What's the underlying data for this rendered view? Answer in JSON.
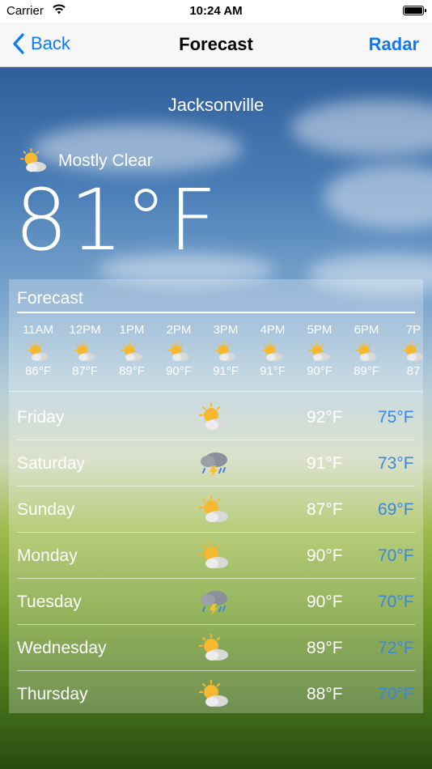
{
  "status_bar": {
    "carrier": "Carrier",
    "time": "10:24 AM"
  },
  "nav": {
    "back_label": "Back",
    "title": "Forecast",
    "right_label": "Radar"
  },
  "current": {
    "city": "Jacksonville",
    "condition": "Mostly Clear",
    "condition_icon": "sun-cloud-icon",
    "temperature": "81°F"
  },
  "forecast_panel": {
    "title": "Forecast",
    "hourly": [
      {
        "time": "11AM",
        "temp": "86°F",
        "icon": "sun-cloud-icon"
      },
      {
        "time": "12PM",
        "temp": "87°F",
        "icon": "sun-cloud-icon"
      },
      {
        "time": "1PM",
        "temp": "89°F",
        "icon": "sun-cloud-icon"
      },
      {
        "time": "2PM",
        "temp": "90°F",
        "icon": "sun-cloud-icon"
      },
      {
        "time": "3PM",
        "temp": "91°F",
        "icon": "sun-cloud-icon"
      },
      {
        "time": "4PM",
        "temp": "91°F",
        "icon": "sun-cloud-icon"
      },
      {
        "time": "5PM",
        "temp": "90°F",
        "icon": "sun-cloud-icon"
      },
      {
        "time": "6PM",
        "temp": "89°F",
        "icon": "sun-cloud-icon"
      },
      {
        "time": "7P",
        "temp": "87",
        "icon": "sun-cloud-icon"
      }
    ],
    "daily": [
      {
        "day": "Friday",
        "icon": "sun-cloud-icon",
        "high": "92°F",
        "low": "75°F"
      },
      {
        "day": "Saturday",
        "icon": "thunderstorm-icon",
        "high": "91°F",
        "low": "73°F"
      },
      {
        "day": "Sunday",
        "icon": "sun-cloud-icon",
        "high": "87°F",
        "low": "69°F"
      },
      {
        "day": "Monday",
        "icon": "sun-cloud-icon",
        "high": "90°F",
        "low": "70°F"
      },
      {
        "day": "Tuesday",
        "icon": "thunderstorm-icon",
        "high": "90°F",
        "low": "70°F"
      },
      {
        "day": "Wednesday",
        "icon": "sun-cloud-icon",
        "high": "89°F",
        "low": "72°F"
      },
      {
        "day": "Thursday",
        "icon": "sun-cloud-icon",
        "high": "88°F",
        "low": "70°F"
      }
    ]
  },
  "colors": {
    "accent": "#0a7aff",
    "low_temp": "#3a86e0"
  }
}
